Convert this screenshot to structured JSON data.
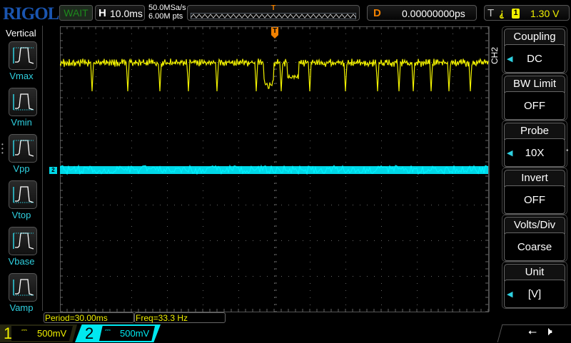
{
  "header": {
    "logo": "RIGOL",
    "status": "WAIT",
    "h_label": "H",
    "timebase": "10.0ms",
    "sample_rate": "50.0MSa/s",
    "memory_depth": "6.00M pts",
    "delay_label": "D",
    "delay": "0.00000000ps",
    "trigger_label": "T",
    "trigger_source": "1",
    "trigger_level": "1.30 V"
  },
  "left_menu": {
    "title": "Vertical",
    "items": [
      {
        "label": "Vmax"
      },
      {
        "label": "Vmin"
      },
      {
        "label": "Vpp"
      },
      {
        "label": "Vtop"
      },
      {
        "label": "Vbase"
      },
      {
        "label": "Vamp"
      }
    ]
  },
  "right_menu": {
    "channel": "CH2",
    "items": [
      {
        "title": "Coupling",
        "value": "DC",
        "arrow": true
      },
      {
        "title": "BW Limit",
        "value": "OFF",
        "arrow": false
      },
      {
        "title": "Probe",
        "value": "10X",
        "arrow": true
      },
      {
        "title": "Invert",
        "value": "OFF",
        "arrow": false
      },
      {
        "title": "Volts/Div",
        "value": "Coarse",
        "arrow": false
      },
      {
        "title": "Unit",
        "value": "[V]",
        "arrow": true
      }
    ]
  },
  "measurements": {
    "period": "Period=30.00ms",
    "freq": "Freq=33.3 Hz"
  },
  "channels": [
    {
      "num": "1",
      "coupling": "⎓",
      "scale": "500mV",
      "color": "#f0f000"
    },
    {
      "num": "2",
      "coupling": "⎓",
      "scale": "500mV",
      "color": "#00e8f0"
    }
  ],
  "markers": {
    "trigger": "T",
    "ch2": "2"
  }
}
